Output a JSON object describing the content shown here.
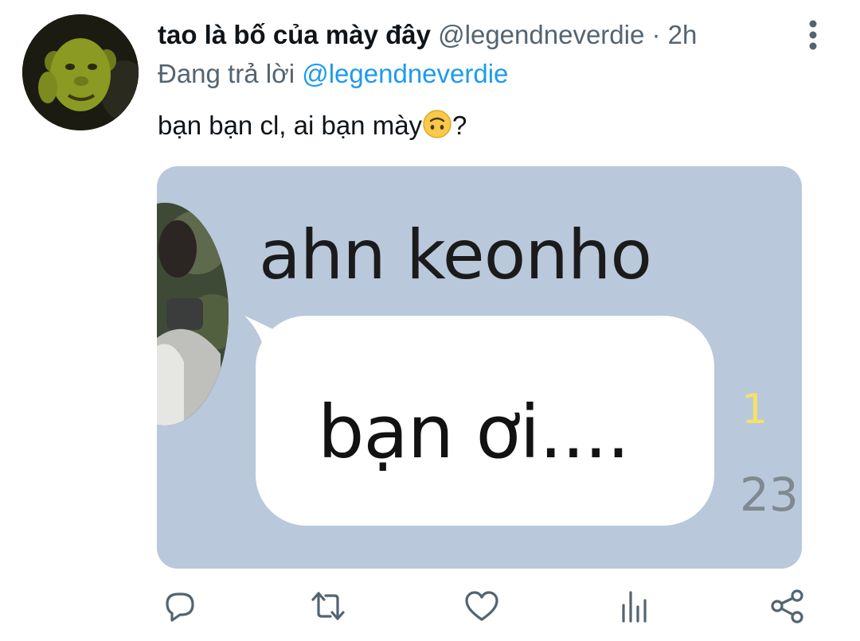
{
  "tweet": {
    "display_name": "tao là bố của mày đây",
    "handle": "@legendneverdie",
    "separator": "·",
    "time": "2h",
    "reply_prefix": "Đang trả lời",
    "reply_to": "@legendneverdie",
    "text": "bạn bạn cl, ai bạn mày",
    "text_suffix": "?",
    "emoji": "upside-down-face-emoji"
  },
  "media": {
    "contact_name": "ahn keonho",
    "message": "bạn ơi....",
    "unread_count": "1",
    "time_fragment": "23"
  },
  "icons": {
    "more": "more-vertical-icon",
    "reply": "reply-icon",
    "retweet": "retweet-icon",
    "like": "heart-icon",
    "analytics": "analytics-icon",
    "share": "share-icon"
  },
  "colors": {
    "link": "#1d9bf0",
    "secondary_text": "#536471",
    "media_background": "#b9c8da",
    "unread": "#f2e26a"
  }
}
